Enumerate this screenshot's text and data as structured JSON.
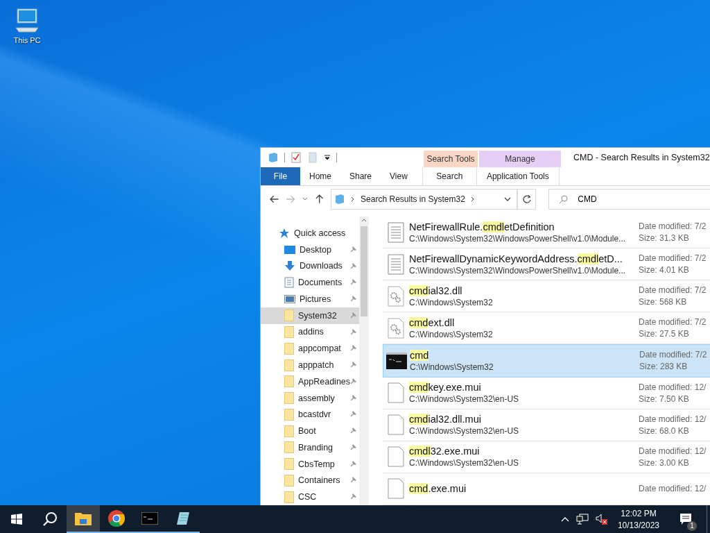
{
  "desktop": {
    "icons": [
      {
        "label": "This PC"
      }
    ]
  },
  "window": {
    "title": "CMD - Search Results in System32",
    "ribbon": {
      "tabs": [
        {
          "label": "File",
          "kind": "file",
          "selected": false
        },
        {
          "label": "Home",
          "kind": "plain",
          "selected": false
        },
        {
          "label": "Share",
          "kind": "plain",
          "selected": false
        },
        {
          "label": "View",
          "kind": "plain",
          "selected": false
        }
      ],
      "context_groups": [
        {
          "label": "Search Tools",
          "color": "#f9d6c6",
          "tab": "Search"
        },
        {
          "label": "Manage",
          "color": "#e6cff7",
          "tab": "Application Tools"
        }
      ]
    },
    "address": {
      "path": "Search Results in System32"
    },
    "search": {
      "value": "CMD"
    },
    "sidebar": {
      "items": [
        {
          "label": "Quick access",
          "kind": "star",
          "selected": false
        },
        {
          "label": "Desktop",
          "kind": "desktop",
          "selected": false
        },
        {
          "label": "Downloads",
          "kind": "download",
          "selected": false
        },
        {
          "label": "Documents",
          "kind": "documents",
          "selected": false
        },
        {
          "label": "Pictures",
          "kind": "pictures",
          "selected": false
        },
        {
          "label": "System32",
          "kind": "folder",
          "selected": true
        },
        {
          "label": "addins",
          "kind": "folder",
          "selected": false
        },
        {
          "label": "appcompat",
          "kind": "folder",
          "selected": false
        },
        {
          "label": "apppatch",
          "kind": "folder",
          "selected": false
        },
        {
          "label": "AppReadines",
          "kind": "folder",
          "selected": false
        },
        {
          "label": "assembly",
          "kind": "folder",
          "selected": false
        },
        {
          "label": "bcastdvr",
          "kind": "folder",
          "selected": false
        },
        {
          "label": "Boot",
          "kind": "folder",
          "selected": false
        },
        {
          "label": "Branding",
          "kind": "folder",
          "selected": false
        },
        {
          "label": "CbsTemp",
          "kind": "folder",
          "selected": false
        },
        {
          "label": "Containers",
          "kind": "folder",
          "selected": false
        },
        {
          "label": "CSC",
          "kind": "folder",
          "selected": false
        }
      ]
    },
    "results": [
      {
        "kind": "document",
        "prefix": "NetFirewallRule.",
        "match": "cmdl",
        "rest": "etDefinition",
        "path": "C:\\Windows\\System32\\WindowsPowerShell\\v1.0\\Module...",
        "date": "Date modified: 7/2",
        "size": "Size: 31.3 KB",
        "selected": false
      },
      {
        "kind": "document",
        "prefix": "NetFirewallDynamicKeywordAddress.",
        "match": "cmdl",
        "rest": "etD...",
        "path": "C:\\Windows\\System32\\WindowsPowerShell\\v1.0\\Module...",
        "date": "Date modified: 7/2",
        "size": "Size: 4.01 KB",
        "selected": false
      },
      {
        "kind": "dll",
        "match": "cmd",
        "rest": "ial32.dll",
        "path": "C:\\Windows\\System32",
        "date": "Date modified: 7/2",
        "size": "Size: 568 KB",
        "selected": false
      },
      {
        "kind": "dll",
        "match": "cmd",
        "rest": "ext.dll",
        "path": "C:\\Windows\\System32",
        "date": "Date modified: 7/2",
        "size": "Size: 27.5 KB",
        "selected": false
      },
      {
        "kind": "exe",
        "match": "cmd",
        "path": "C:\\Windows\\System32",
        "date": "Date modified: 7/2",
        "size": "Size: 283 KB",
        "selected": true
      },
      {
        "kind": "file",
        "match": "cmd",
        "rest": "key.exe.mui",
        "path": "C:\\Windows\\System32\\en-US",
        "date": "Date modified: 12/",
        "size": "Size: 7.50 KB",
        "selected": false
      },
      {
        "kind": "file",
        "match": "cmd",
        "rest": "ial32.dll.mui",
        "path": "C:\\Windows\\System32\\en-US",
        "date": "Date modified: 12/",
        "size": "Size: 68.0 KB",
        "selected": false
      },
      {
        "kind": "file",
        "match": "cmdl",
        "rest": "32.exe.mui",
        "path": "C:\\Windows\\System32\\en-US",
        "date": "Date modified: 12/",
        "size": "Size: 3.00 KB",
        "selected": false
      },
      {
        "kind": "file",
        "match": "cmd",
        "rest": ".exe.mui",
        "date": "Date modified: 12/",
        "selected": false
      }
    ]
  },
  "taskbar": {
    "apps": [
      {
        "kind": "explorer",
        "selected": true
      },
      {
        "kind": "chrome",
        "selected": false
      },
      {
        "kind": "cmd",
        "selected": false
      },
      {
        "kind": "notepad",
        "selected": false
      }
    ],
    "clock": {
      "time": "12:02 PM",
      "date": "10/13/2023"
    },
    "notifications": "1"
  }
}
